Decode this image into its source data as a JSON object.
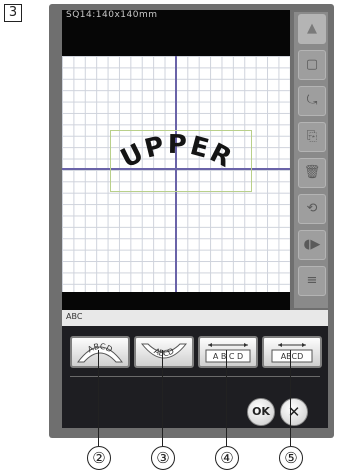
{
  "step_number": "3",
  "screen": {
    "hoop_label": "SQ14:140x140mm",
    "pattern_text": "UPPER"
  },
  "side_panel": {
    "buttons": [
      "▲",
      "▢",
      "⤿",
      "⎘",
      "🗑",
      "⟲",
      "◖▶",
      "≡"
    ]
  },
  "dialog": {
    "title_icon": "ABC",
    "style_buttons": [
      {
        "name": "arc-up",
        "sample": "ABCD"
      },
      {
        "name": "arc-down",
        "sample": "ABCD"
      },
      {
        "name": "spacing-wide",
        "sample": "A B C D"
      },
      {
        "name": "spacing-narrow",
        "sample": "ABCD"
      }
    ],
    "ok_label": "OK",
    "cancel_label": "✕"
  },
  "callouts": [
    "②",
    "③",
    "④",
    "⑤"
  ],
  "colors": {
    "device_body": "#6f6f6f",
    "screen_black": "#060606",
    "axis": "#6a63a8",
    "grid": "#cfd3dc"
  }
}
